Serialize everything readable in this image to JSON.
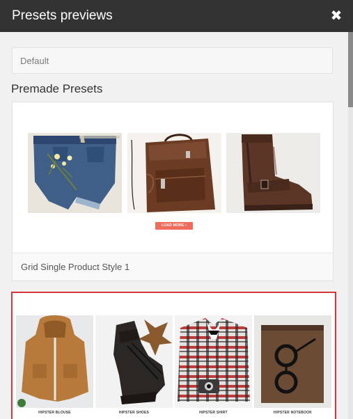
{
  "titlebar": {
    "title": "Presets previews",
    "close_icon": "close-icon"
  },
  "default": {
    "label": "Default"
  },
  "section": {
    "title": "Premade Presets"
  },
  "preset1": {
    "name": "Grid Single Product Style 1",
    "load_more": "LOAD MORE",
    "products": [
      "denim shorts",
      "leather backpack",
      "brown boot"
    ]
  },
  "preset2": {
    "labels": [
      "HIPSTER BLOUSE",
      "HIPSTER SHOES",
      "HIPSTER SHIRT",
      "HIPSTER NOTEBOOK"
    ]
  },
  "colors": {
    "titlebar": "#333333",
    "highlight": "#d8323c",
    "button": "#ef6b5a"
  }
}
